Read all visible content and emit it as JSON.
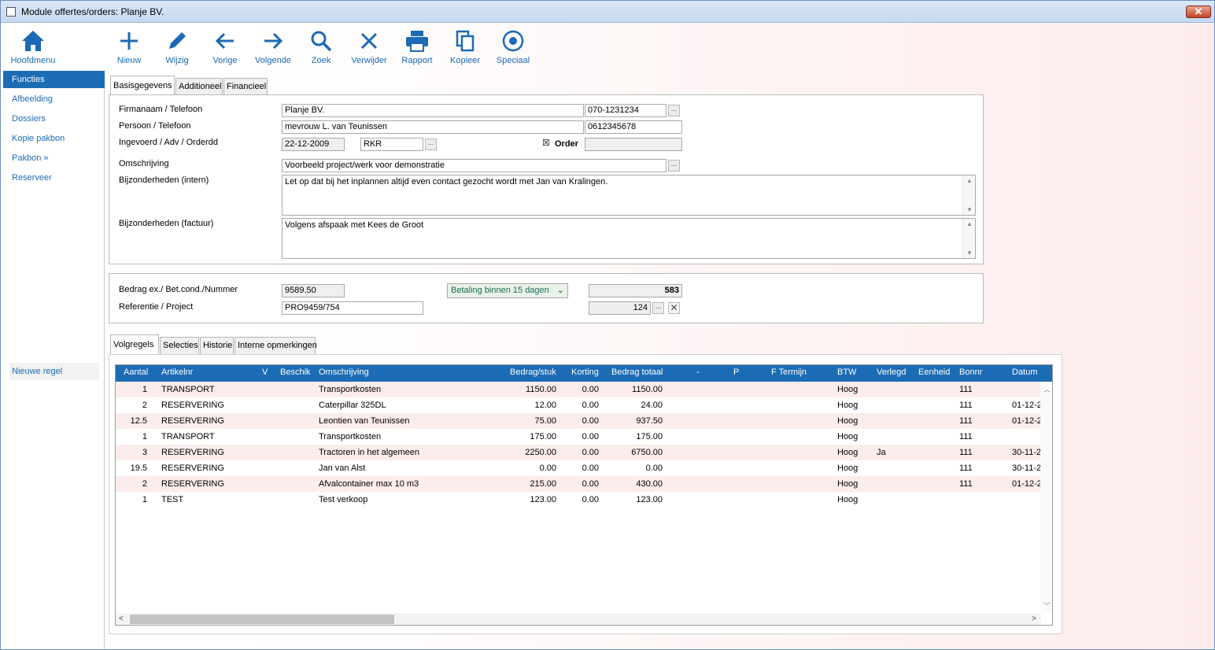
{
  "window": {
    "title": "Module offertes/orders: Planje BV.",
    "close": "✕"
  },
  "toolbar": {
    "home": "Hoofdmenu",
    "new": "Nieuw",
    "edit": "Wijzig",
    "prev": "Vorige",
    "next": "Volgende",
    "search": "Zoek",
    "delete": "Verwijder",
    "report": "Rapport",
    "copy": "Kopieer",
    "special": "Speciaal"
  },
  "sidebar": {
    "items": [
      "Functies",
      "Afbeelding",
      "Dossiers",
      "Kopie pakbon",
      "Pakbon »",
      "Reserveer"
    ],
    "new_row": "Nieuwe regel"
  },
  "tabs_top": [
    "Basisgegevens",
    "Additioneel",
    "Financieel"
  ],
  "form": {
    "firm_label": "Firmanaam / Telefoon",
    "firm": "Planje BV.",
    "phone": "070-1231234",
    "person_label": "Persoon / Telefoon",
    "person": "mevrouw L. van Teunissen",
    "person_phone": "0612345678",
    "entered_label": "Ingevoerd / Adv / Orderdd",
    "entered_date": "22-12-2009",
    "adv": "RKR",
    "order_label": "Order",
    "order_checked": "☒",
    "order_date": "",
    "desc_label": "Omschrijving",
    "desc": "Voorbeeld project/werk voor demonstratie",
    "intern_label": "Bijzonderheden (intern)",
    "intern": "Let op dat bij het inplannen altijd even contact gezocht wordt met Jan van Kralingen.",
    "invoice_label": "Bijzonderheden (factuur)",
    "invoice": "Volgens afspaak met Kees de Groot"
  },
  "amount": {
    "label": "Bedrag ex./ Bet.cond./Nummer",
    "value": "9589.50",
    "condition": "Betaling binnen 15 dagen",
    "number": "583",
    "ref_label": "Referentie / Project",
    "ref": "PRO9459/754",
    "project": "124"
  },
  "tabs_bottom": [
    "Volgregels",
    "Selecties",
    "Historie",
    "Interne opmerkingen"
  ],
  "grid": {
    "columns": [
      "Aantal",
      "Artikelnr",
      "V",
      "Beschik",
      "Omschrijving",
      "Bedrag/stuk",
      "Korting",
      "Bedrag totaal",
      "-",
      "P",
      "F Termijn",
      "BTW",
      "Verlegd",
      "Eenheid",
      "Bonnr",
      "Datum"
    ],
    "rows": [
      {
        "aantal": "1",
        "artikel": "TRANSPORT",
        "omschr": "Transportkosten",
        "stuk": "1150.00",
        "korting": "0.00",
        "totaal": "1150.00",
        "btw": "Hoog",
        "verlegd": "",
        "bonnr": "111",
        "datum": ""
      },
      {
        "aantal": "2",
        "artikel": "RESERVERING",
        "omschr": "Caterpillar 325DL",
        "stuk": "12.00",
        "korting": "0.00",
        "totaal": "24.00",
        "btw": "Hoog",
        "verlegd": "",
        "bonnr": "111",
        "datum": "01-12-2"
      },
      {
        "aantal": "12.5",
        "artikel": "RESERVERING",
        "omschr": "Leontien van Teunissen",
        "stuk": "75.00",
        "korting": "0.00",
        "totaal": "937.50",
        "btw": "Hoog",
        "verlegd": "",
        "bonnr": "111",
        "datum": "01-12-2"
      },
      {
        "aantal": "1",
        "artikel": "TRANSPORT",
        "omschr": "Transportkosten",
        "stuk": "175.00",
        "korting": "0.00",
        "totaal": "175.00",
        "btw": "Hoog",
        "verlegd": "",
        "bonnr": "111",
        "datum": ""
      },
      {
        "aantal": "3",
        "artikel": "RESERVERING",
        "omschr": "Tractoren in het algemeen",
        "stuk": "2250.00",
        "korting": "0.00",
        "totaal": "6750.00",
        "btw": "Hoog",
        "verlegd": "Ja",
        "bonnr": "111",
        "datum": "30-11-2"
      },
      {
        "aantal": "19.5",
        "artikel": "RESERVERING",
        "omschr": "Jan van Alst",
        "stuk": "0.00",
        "korting": "0.00",
        "totaal": "0.00",
        "btw": "Hoog",
        "verlegd": "",
        "bonnr": "111",
        "datum": "30-11-2"
      },
      {
        "aantal": "2",
        "artikel": "RESERVERING",
        "omschr": "Afvalcontainer max 10 m3",
        "stuk": "215.00",
        "korting": "0.00",
        "totaal": "430.00",
        "btw": "Hoog",
        "verlegd": "",
        "bonnr": "111",
        "datum": "01-12-2"
      },
      {
        "aantal": "1",
        "artikel": "TEST",
        "omschr": "Test verkoop",
        "stuk": "123.00",
        "korting": "0.00",
        "totaal": "123.00",
        "btw": "Hoog",
        "verlegd": "",
        "bonnr": "",
        "datum": ""
      }
    ]
  },
  "colors": {
    "accent": "#1c6cb5",
    "row_alt": "#fdecec"
  }
}
